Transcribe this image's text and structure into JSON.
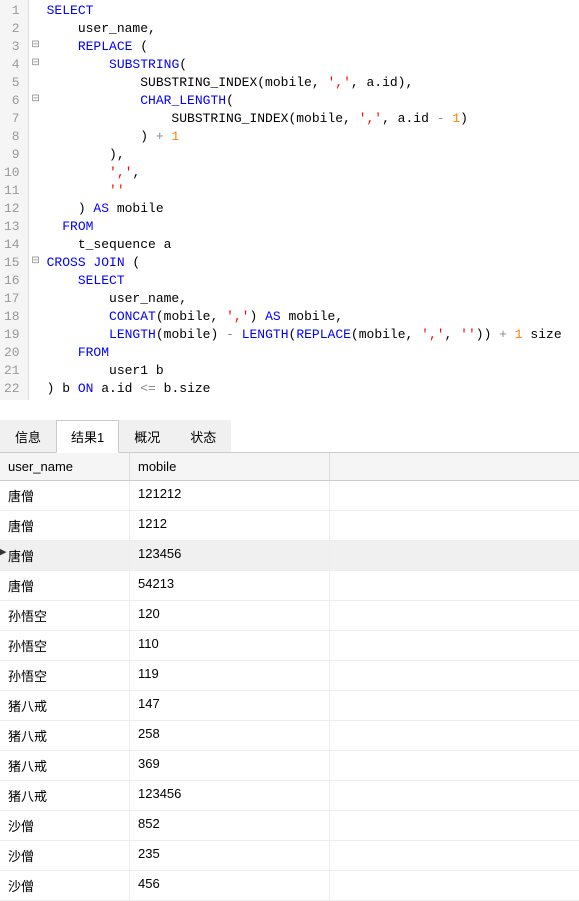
{
  "code": {
    "lines": [
      {
        "n": 1,
        "fold": "",
        "tokens": [
          [
            "kw",
            "SELECT"
          ]
        ]
      },
      {
        "n": 2,
        "fold": "",
        "tokens": [
          [
            "",
            "    user_name,"
          ]
        ]
      },
      {
        "n": 3,
        "fold": "⊟",
        "tokens": [
          [
            "",
            "    "
          ],
          [
            "kw",
            "REPLACE"
          ],
          [
            "",
            " ("
          ]
        ]
      },
      {
        "n": 4,
        "fold": "⊟",
        "tokens": [
          [
            "",
            "        "
          ],
          [
            "kw",
            "SUBSTRING"
          ],
          [
            "",
            "("
          ]
        ]
      },
      {
        "n": 5,
        "fold": "",
        "tokens": [
          [
            "",
            "            SUBSTRING_INDEX(mobile, "
          ],
          [
            "str",
            "','"
          ],
          [
            "",
            ", a.id),"
          ]
        ]
      },
      {
        "n": 6,
        "fold": "⊟",
        "tokens": [
          [
            "",
            "            "
          ],
          [
            "kw",
            "CHAR_LENGTH"
          ],
          [
            "",
            "("
          ]
        ]
      },
      {
        "n": 7,
        "fold": "",
        "tokens": [
          [
            "",
            "                SUBSTRING_INDEX(mobile, "
          ],
          [
            "str",
            "','"
          ],
          [
            "",
            ", a.id "
          ],
          [
            "op",
            "-"
          ],
          [
            "",
            " "
          ],
          [
            "num",
            "1"
          ],
          [
            "",
            ")"
          ]
        ]
      },
      {
        "n": 8,
        "fold": "",
        "tokens": [
          [
            "",
            "            ) "
          ],
          [
            "op",
            "+"
          ],
          [
            "",
            " "
          ],
          [
            "num",
            "1"
          ]
        ]
      },
      {
        "n": 9,
        "fold": "",
        "tokens": [
          [
            "",
            "        ),"
          ]
        ]
      },
      {
        "n": 10,
        "fold": "",
        "tokens": [
          [
            "",
            "        "
          ],
          [
            "str",
            "','"
          ],
          [
            "",
            ","
          ]
        ]
      },
      {
        "n": 11,
        "fold": "",
        "tokens": [
          [
            "",
            "        "
          ],
          [
            "str",
            "''"
          ]
        ]
      },
      {
        "n": 12,
        "fold": "",
        "tokens": [
          [
            "",
            "    ) "
          ],
          [
            "kw",
            "AS"
          ],
          [
            "",
            " mobile"
          ]
        ]
      },
      {
        "n": 13,
        "fold": "",
        "tokens": [
          [
            "",
            "  "
          ],
          [
            "kw",
            "FROM"
          ]
        ]
      },
      {
        "n": 14,
        "fold": "",
        "tokens": [
          [
            "",
            "    t_sequence a"
          ]
        ]
      },
      {
        "n": 15,
        "fold": "⊟",
        "tokens": [
          [
            "kw",
            "CROSS JOIN"
          ],
          [
            "",
            " ("
          ]
        ]
      },
      {
        "n": 16,
        "fold": "",
        "tokens": [
          [
            "",
            "    "
          ],
          [
            "kw",
            "SELECT"
          ]
        ]
      },
      {
        "n": 17,
        "fold": "",
        "tokens": [
          [
            "",
            "        user_name,"
          ]
        ]
      },
      {
        "n": 18,
        "fold": "",
        "tokens": [
          [
            "",
            "        "
          ],
          [
            "kw",
            "CONCAT"
          ],
          [
            "",
            "(mobile, "
          ],
          [
            "str",
            "','"
          ],
          [
            "",
            ") "
          ],
          [
            "kw",
            "AS"
          ],
          [
            "",
            " mobile,"
          ]
        ]
      },
      {
        "n": 19,
        "fold": "",
        "tokens": [
          [
            "",
            "        "
          ],
          [
            "kw",
            "LENGTH"
          ],
          [
            "",
            "(mobile) "
          ],
          [
            "op",
            "-"
          ],
          [
            "",
            " "
          ],
          [
            "kw",
            "LENGTH"
          ],
          [
            "",
            "("
          ],
          [
            "kw",
            "REPLACE"
          ],
          [
            "",
            "(mobile, "
          ],
          [
            "str",
            "','"
          ],
          [
            "",
            ", "
          ],
          [
            "str",
            "''"
          ],
          [
            "",
            ")) "
          ],
          [
            "op",
            "+"
          ],
          [
            "",
            " "
          ],
          [
            "num",
            "1"
          ],
          [
            "",
            " size"
          ]
        ]
      },
      {
        "n": 20,
        "fold": "",
        "tokens": [
          [
            "",
            "    "
          ],
          [
            "kw",
            "FROM"
          ]
        ]
      },
      {
        "n": 21,
        "fold": "",
        "tokens": [
          [
            "",
            "        user1 b"
          ]
        ]
      },
      {
        "n": 22,
        "fold": "",
        "tokens": [
          [
            "",
            ") b "
          ],
          [
            "kw",
            "ON"
          ],
          [
            "",
            " a.id "
          ],
          [
            "op",
            "<="
          ],
          [
            "",
            " b.size"
          ]
        ]
      }
    ]
  },
  "tabs": [
    {
      "id": "info",
      "label": "信息",
      "active": false
    },
    {
      "id": "result1",
      "label": "结果1",
      "active": true
    },
    {
      "id": "profile",
      "label": "概况",
      "active": false
    },
    {
      "id": "status",
      "label": "状态",
      "active": false
    }
  ],
  "grid": {
    "headers": [
      {
        "key": "user_name",
        "label": "user_name"
      },
      {
        "key": "mobile",
        "label": "mobile"
      }
    ],
    "rows": [
      {
        "user_name": "唐僧",
        "mobile": "121212",
        "sel": false
      },
      {
        "user_name": "唐僧",
        "mobile": "1212",
        "sel": false
      },
      {
        "user_name": "唐僧",
        "mobile": "123456",
        "sel": true
      },
      {
        "user_name": "唐僧",
        "mobile": "54213",
        "sel": false
      },
      {
        "user_name": "孙悟空",
        "mobile": "120",
        "sel": false
      },
      {
        "user_name": "孙悟空",
        "mobile": "110",
        "sel": false
      },
      {
        "user_name": "孙悟空",
        "mobile": "119",
        "sel": false
      },
      {
        "user_name": "猪八戒",
        "mobile": "147",
        "sel": false
      },
      {
        "user_name": "猪八戒",
        "mobile": "258",
        "sel": false
      },
      {
        "user_name": "猪八戒",
        "mobile": "369",
        "sel": false
      },
      {
        "user_name": "猪八戒",
        "mobile": "123456",
        "sel": false
      },
      {
        "user_name": "沙僧",
        "mobile": "852",
        "sel": false
      },
      {
        "user_name": "沙僧",
        "mobile": "235",
        "sel": false
      },
      {
        "user_name": "沙僧",
        "mobile": "456",
        "sel": false
      }
    ]
  }
}
